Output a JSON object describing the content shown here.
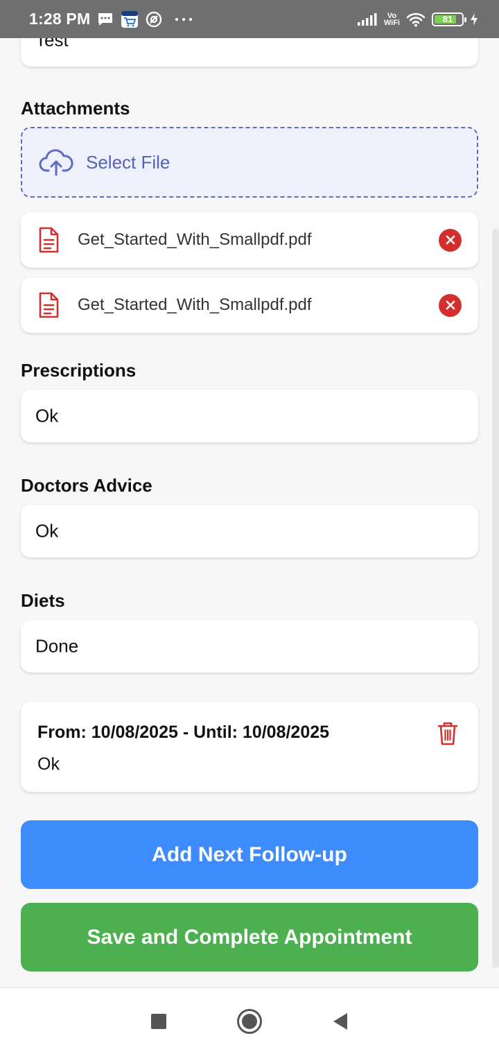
{
  "status_bar": {
    "time": "1:28 PM",
    "battery": "81",
    "battery_level": 0.81,
    "network_label_top": "Vo",
    "network_label_bottom": "WiFi"
  },
  "form": {
    "previous_field_value": "Test",
    "attachments": {
      "label": "Attachments",
      "select_label": "Select File",
      "files": [
        {
          "name": "Get_Started_With_Smallpdf.pdf"
        },
        {
          "name": "Get_Started_With_Smallpdf.pdf"
        }
      ]
    },
    "prescriptions": {
      "label": "Prescriptions",
      "value": "Ok"
    },
    "doctors_advice": {
      "label": "Doctors Advice",
      "value": "Ok"
    },
    "diets": {
      "label": "Diets",
      "value": "Done"
    }
  },
  "follow_up": {
    "title": "From: 10/08/2025 - Until: 10/08/2025",
    "note": "Ok"
  },
  "buttons": {
    "add_follow_up": "Add Next Follow-up",
    "save_complete": "Save and Complete Appointment"
  },
  "colors": {
    "primary_blue": "#3d8bfd",
    "success_green": "#4caf50",
    "danger_red": "#d32f2f",
    "indigo": "#5c6bc0"
  }
}
